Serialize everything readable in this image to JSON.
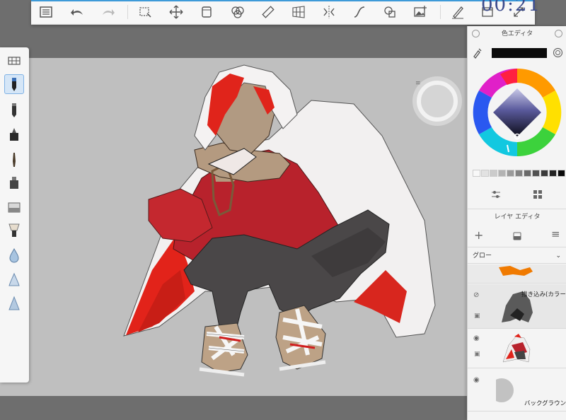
{
  "timer": "00:21",
  "colors": {
    "canvas_bg": "#bfbfbf",
    "accent": "#3d9ad8",
    "current_color": "#0a0a0a"
  },
  "toolbar": {
    "icons": [
      "list-icon",
      "undo-icon",
      "redo-icon",
      "select-icon",
      "transform-icon",
      "layer-stack-icon",
      "blend-icon",
      "ruler-icon",
      "perspective-icon",
      "symmetry-icon",
      "curve-icon",
      "shape-icon",
      "add-image-icon",
      "pen-settings-icon",
      "window-icon",
      "fullscreen-icon"
    ]
  },
  "tools": [
    "brush-palette-icon",
    "pencil-icon",
    "ballpoint-icon",
    "marker-icon",
    "paintbrush-icon",
    "airbrush-icon",
    "eraser-icon",
    "smudge-brush-icon",
    "blur-drop-icon",
    "cone-icon",
    "triangle-icon"
  ],
  "color_editor": {
    "title": "色エディタ"
  },
  "layer_editor": {
    "title": "レイヤ エディタ",
    "blend_mode": "グロー",
    "layers": [
      {
        "name": ""
      },
      {
        "name": "描き込み(カラー)"
      },
      {
        "name": ""
      },
      {
        "name": "バックグラウンド"
      }
    ]
  }
}
